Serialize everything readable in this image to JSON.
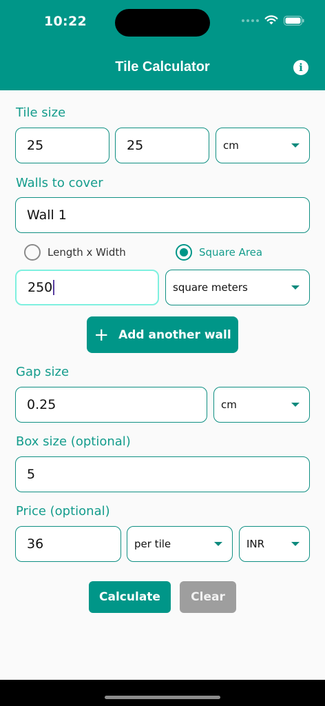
{
  "status": {
    "time": "10:22"
  },
  "header": {
    "title": "Tile Calculator",
    "info_icon": "info-icon"
  },
  "tile_size": {
    "label": "Tile size",
    "length": "25",
    "width": "25",
    "unit": "cm"
  },
  "walls": {
    "label": "Walls to cover",
    "wall_name": "Wall 1",
    "mode_length_width": "Length x Width",
    "mode_square_area": "Square Area",
    "selected_mode": "Square Area",
    "area_value": "250",
    "area_unit": "square meters",
    "add_button": "Add another wall"
  },
  "gap": {
    "label": "Gap size",
    "value": "0.25",
    "unit": "cm"
  },
  "box": {
    "label": "Box size (optional)",
    "value": "5"
  },
  "price": {
    "label": "Price (optional)",
    "value": "36",
    "per": "per tile",
    "currency": "INR"
  },
  "actions": {
    "calculate": "Calculate",
    "clear": "Clear"
  },
  "colors": {
    "primary": "#009688",
    "label_text": "#149c8c",
    "clear_button": "#9e9e9e"
  }
}
